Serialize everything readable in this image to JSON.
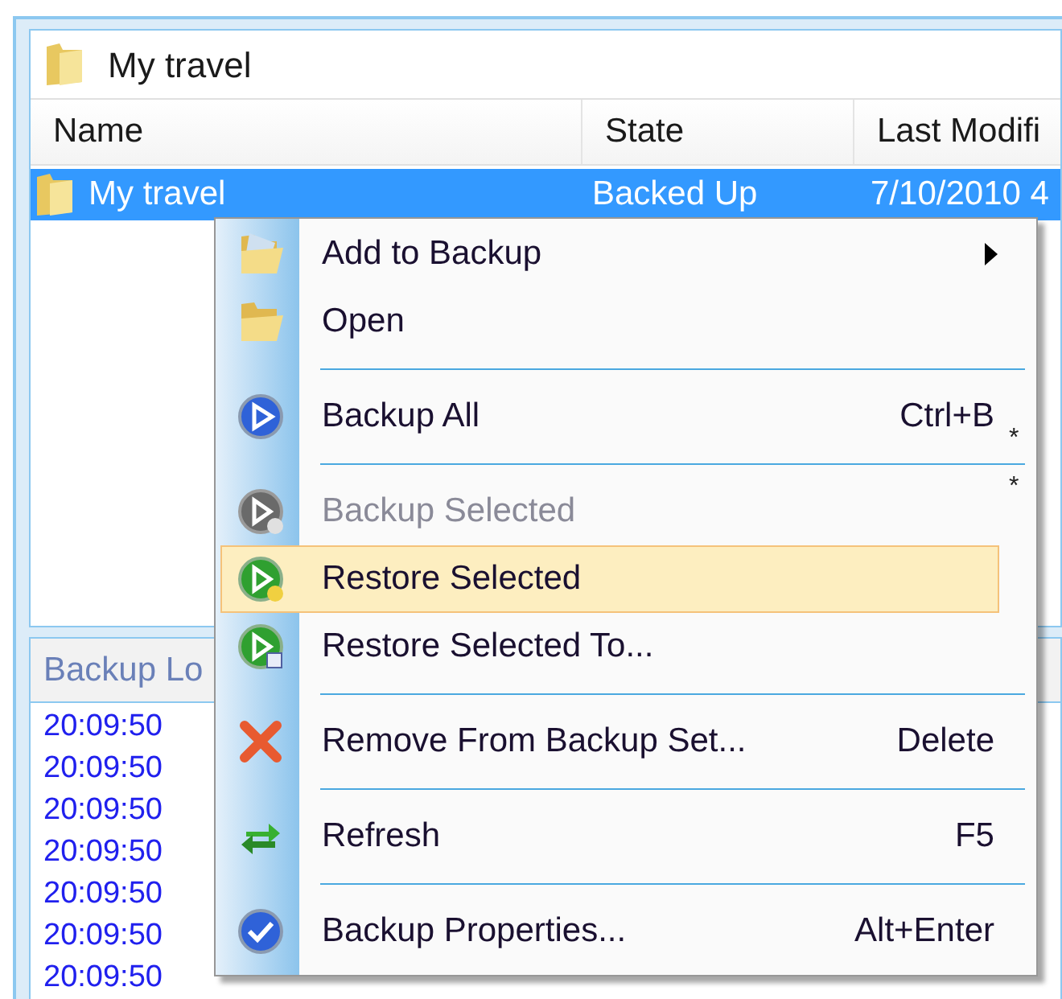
{
  "location": {
    "title": "My travel"
  },
  "table": {
    "columns": [
      "Name",
      "State",
      "Last Modifi"
    ],
    "rows": [
      {
        "name": "My travel",
        "state": "Backed Up",
        "modified": "7/10/2010 4",
        "selected": true
      }
    ]
  },
  "log": {
    "title": "Backup Lo",
    "times": [
      "20:09:50",
      "20:09:50",
      "20:09:50",
      "20:09:50",
      "20:09:50",
      "20:09:50",
      "20:09:50"
    ]
  },
  "context_menu": {
    "items": [
      {
        "kind": "item",
        "label": "Add to Backup",
        "submenu": true,
        "disabled": false,
        "selected": false
      },
      {
        "kind": "item",
        "label": "Open",
        "submenu": false,
        "disabled": false,
        "selected": false
      },
      {
        "kind": "separator"
      },
      {
        "kind": "item",
        "label": "Backup All",
        "shortcut": "Ctrl+B",
        "submenu": false,
        "disabled": false,
        "selected": false
      },
      {
        "kind": "separator"
      },
      {
        "kind": "item",
        "label": "Backup Selected",
        "submenu": false,
        "disabled": true,
        "selected": false
      },
      {
        "kind": "item",
        "label": "Restore Selected",
        "submenu": false,
        "disabled": false,
        "selected": true
      },
      {
        "kind": "item",
        "label": "Restore Selected To...",
        "submenu": false,
        "disabled": false,
        "selected": false
      },
      {
        "kind": "separator"
      },
      {
        "kind": "item",
        "label": "Remove From Backup Set...",
        "shortcut": "Delete",
        "submenu": false,
        "disabled": false,
        "selected": false
      },
      {
        "kind": "separator"
      },
      {
        "kind": "item",
        "label": "Refresh",
        "shortcut": "F5",
        "submenu": false,
        "disabled": false,
        "selected": false
      },
      {
        "kind": "separator"
      },
      {
        "kind": "item",
        "label": "Backup Properties...",
        "shortcut": "Alt+Enter",
        "submenu": false,
        "disabled": false,
        "selected": false
      }
    ],
    "marks": [
      "*",
      "*"
    ]
  }
}
